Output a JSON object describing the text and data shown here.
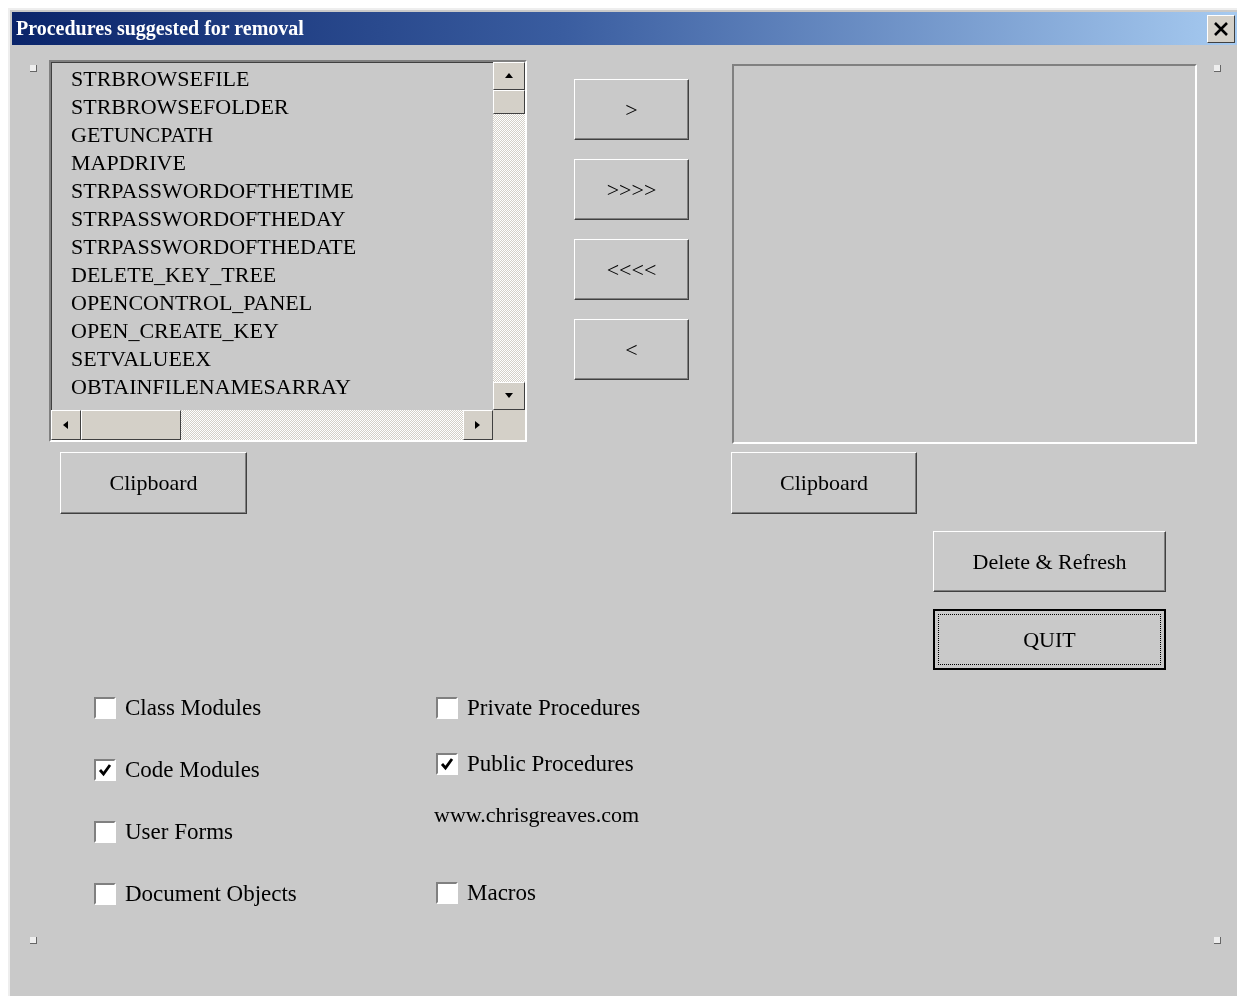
{
  "window": {
    "title": "Procedures suggested for removal"
  },
  "available_list": {
    "items": [
      "STRBROWSEFILE",
      "STRBROWSEFOLDER",
      "GETUNCPATH",
      "MAPDRIVE",
      "STRPASSWORDOFTHETIME",
      "STRPASSWORDOFTHEDAY",
      "STRPASSWORDOFTHEDATE",
      "DELETE_KEY_TREE",
      "OPENCONTROL_PANEL",
      "OPEN_CREATE_KEY",
      "SETVALUEEX",
      "OBTAINFILENAMESARRAY"
    ]
  },
  "move_buttons": [
    {
      "label": ">"
    },
    {
      "label": ">>>>"
    },
    {
      "label": "<<<<"
    },
    {
      "label": "<"
    }
  ],
  "left_clipboard_button": {
    "label": "Clipboard"
  },
  "right_clipboard_button": {
    "label": "Clipboard"
  },
  "action_buttons": [
    {
      "label": "Delete & Refresh",
      "focused": false
    },
    {
      "label": "QUIT",
      "focused": true
    }
  ],
  "options_left": [
    {
      "label": "Class Modules",
      "checked": false
    },
    {
      "label": "Code Modules",
      "checked": true
    },
    {
      "label": "User Forms",
      "checked": false
    },
    {
      "label": "Document Objects",
      "checked": false
    }
  ],
  "options_right": [
    {
      "kind": "checkbox",
      "label": "Private Procedures",
      "checked": false
    },
    {
      "kind": "checkbox",
      "label": "Public Procedures",
      "checked": true
    },
    {
      "kind": "text",
      "label": "www.chrisgreaves.com"
    },
    {
      "kind": "checkbox",
      "label": "Macros",
      "checked": false
    }
  ]
}
